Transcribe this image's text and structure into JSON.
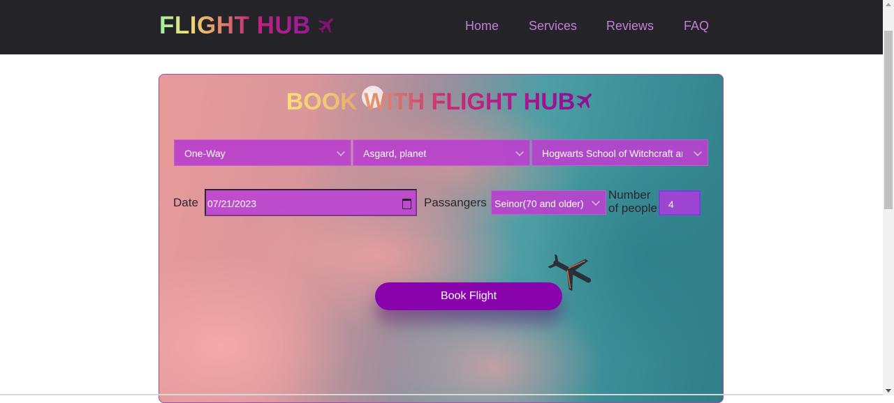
{
  "brand": {
    "logo_text": "FLIGHT HUB",
    "logo_icon": "airplane-icon"
  },
  "nav": {
    "items": [
      "Home",
      "Services",
      "Reviews",
      "FAQ"
    ]
  },
  "colors": {
    "navbar_bg": "#242428",
    "nav_link": "#c57ed8",
    "select_bg": "#b941cd",
    "button_bg": "#8a04ad"
  },
  "booking": {
    "title": "BOOK WITH FLIGHT HUB",
    "trip_type": {
      "selected": "One-Way"
    },
    "origin": {
      "selected": "Asgard, planet"
    },
    "destination": {
      "selected": "Hogwarts School of Witchcraft and Wizardry"
    },
    "date_label": "Date",
    "date_value": "07/21/2023",
    "passengers_label": "Passangers",
    "passenger_type": {
      "selected": "Seinor(70 and older)"
    },
    "people_label": "Number of people",
    "people_value": "4",
    "book_button": "Book Flight"
  }
}
